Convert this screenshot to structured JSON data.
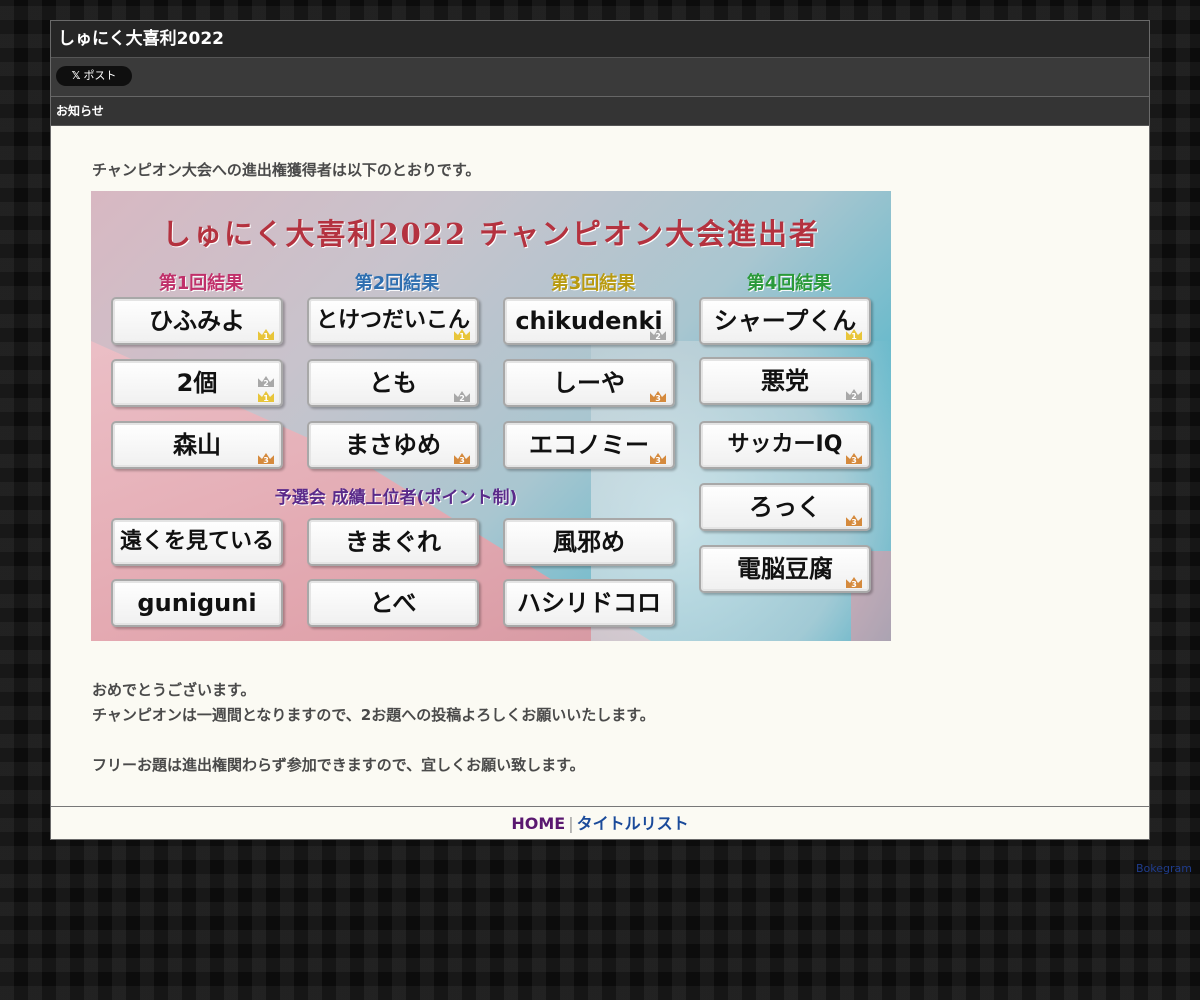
{
  "site": {
    "title": "しゅにく大喜利2022"
  },
  "share": {
    "x_label": "ポスト",
    "x_logo": "𝕏"
  },
  "notice": {
    "heading": "お知らせ"
  },
  "content": {
    "intro": "チャンピオン大会への進出権獲得者は以下のとおりです。",
    "congrats": "おめでとうございます。",
    "champion_note": "チャンピオンは一週間となりますので、2お題への投稿よろしくお願いいたします。",
    "free_note": "フリーお題は進出権関わらず参加できますので、宜しくお願い致します。"
  },
  "banner": {
    "title": "しゅにく大喜利2022 チャンピオン大会進出者",
    "round_labels": [
      "第1回結果",
      "第2回結果",
      "第3回結果",
      "第4回結果"
    ],
    "round_label_colors": [
      "#c0306a",
      "#2f6fb0",
      "#b89a10",
      "#2a9a3a"
    ],
    "preliminary_label": "予選会 成績上位者(ポイント制)",
    "rounds": [
      {
        "names": [
          "ひふみよ",
          "2個",
          "森山"
        ],
        "badges": [
          [
            "1"
          ],
          [
            "2",
            "1"
          ],
          [
            "3"
          ]
        ]
      },
      {
        "names": [
          "とけつだいこん",
          "とも",
          "まさゆめ"
        ],
        "badges": [
          [
            "1"
          ],
          [
            "2"
          ],
          [
            "3"
          ]
        ]
      },
      {
        "names": [
          "chikudenki",
          "しーや",
          "エコノミー"
        ],
        "badges": [
          [
            "2"
          ],
          [
            "3"
          ],
          [
            "3"
          ]
        ]
      },
      {
        "names": [
          "シャープくん",
          "悪党",
          "サッカーIQ",
          "ろっく",
          "電脳豆腐"
        ],
        "badges": [
          [
            "1"
          ],
          [
            "2"
          ],
          [
            "3"
          ],
          [
            "3"
          ],
          [
            "3"
          ]
        ]
      }
    ],
    "preliminary": [
      [
        "遠くを見ている",
        "きまぐれ",
        "風邪め"
      ],
      [
        "guniguni",
        "とべ",
        "ハシリドコロ"
      ]
    ]
  },
  "footer": {
    "home": "HOME",
    "separator": "|",
    "title_list": "タイトルリスト"
  },
  "corner_link": "Bokegram"
}
